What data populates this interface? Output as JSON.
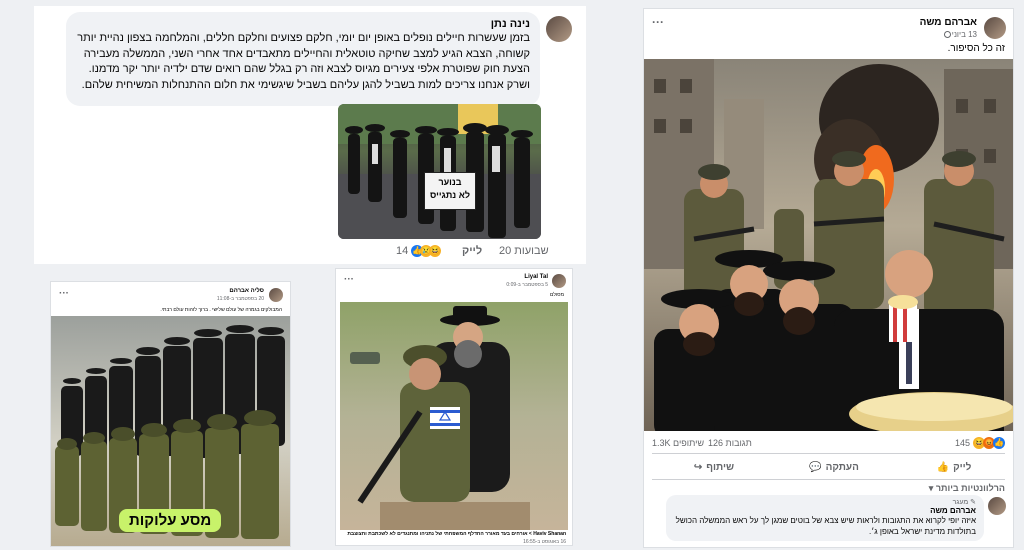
{
  "post_left": {
    "author": "נינה נתן",
    "text": "בזמן שעשרות חיילים נופלים באופן יום יומי, חלקם פצועים וחלקם חללים, והמלחמה בצפון נהיית יותר קשוחה, הצבא הגיע למצב שחיקה טוטאלית והחיילים מתאבדים אחד אחרי השני, הממשלה מעבירה הצעת חוק שפוטרת אלפי צעירים מגיוס לצבא וזה רק בגלל שהם רואים שדם ילדיה יותר יקר מדמנו. ושרק אנחנו צריכים למות בשביל להגן עליהם בשביל שיגשימי את חלום ההתנחלות המשיחית שלהם.",
    "sign_text": "בנוער\nלא נתגייס",
    "time": "20 שבועות",
    "like_label": "לייק",
    "reaction_count": "14"
  },
  "post_right": {
    "author": "אברהם משה",
    "date": "13 ביוני",
    "caption": "זה כל הסיפור.",
    "reactions_count": "145",
    "comments_count": "126 תגובות",
    "shares_count": "1.3K שיתופים",
    "like_label": "לייק",
    "comment_label": "העתקה",
    "share_label": "שיתוף",
    "sort_label": "הרלוונטיות ביותר",
    "comment": {
      "badge": "מעגר",
      "author": "אברהם משה",
      "text": "איזה יופי לקרוא את התגובות ולראות שיש צבא של בוטים שמגן לך על ראש הממשלה הכושל בתולדות מדינת ישראל באופן ג׳."
    }
  },
  "post_bl": {
    "author": "סליה אברהם",
    "date": "20 בספטמבר ב-11:08",
    "caption": "המבולקים בגמרה של עולם שלישי . ברוך לזהות עולם רבתי.",
    "label": "מסע עלוקות"
  },
  "post_bm": {
    "author": "Liyal Tal",
    "date": "5 בספטמבר ב-0:09",
    "caption": "מסולם",
    "footer": "Haviv Shanan > אורחים בעד מאורר החדלף המשפחתי של נתניהו ומתנגדים לא לשכתבת וחצוצבת",
    "footer_date": "16 באוגוסט ב-16:55"
  },
  "colors": {
    "accent": "#1877f2",
    "label_green": "#c8f26a"
  },
  "icons": [
    "more-icon",
    "globe-icon",
    "like-icon",
    "comment-icon",
    "share-icon",
    "pencil-icon"
  ]
}
